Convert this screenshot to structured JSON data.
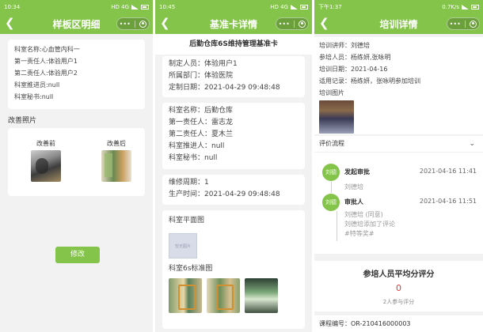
{
  "panel1": {
    "status": {
      "time": "10:34",
      "net": "HD 4G"
    },
    "title": "样板区明细",
    "info": [
      "科室名称:心血管内科一",
      "第一责任人:体验用户1",
      "第二责任人:体验用户2",
      "科室推进员:null",
      "科室秘书:null"
    ],
    "section_title": "改善照片",
    "before_label": "改善前",
    "after_label": "改善后",
    "edit_button": "修改"
  },
  "panel2": {
    "status": {
      "time": "10:45",
      "net": "HD 4G"
    },
    "title": "基准卡详情",
    "header": "后勤仓库6S维持管理基准卡",
    "card1": [
      "制定人员：体验用户1",
      "所属部门：体验医院",
      "定制日期：2021-04-29 09:48:48"
    ],
    "card2": [
      "科室名称：后勤仓库",
      "第一责任人：雷志龙",
      "第二责任人：夏木兰",
      "科室推进人：null",
      "科室秘书：null"
    ],
    "card3": [
      "维修周期：1",
      "生产时间：2021-04-29 09:48:48"
    ],
    "plan_label": "科室平面图",
    "plan_img_text": "暂无图片",
    "std_label": "科室6s标准图"
  },
  "panel3": {
    "status": {
      "time": "下午1:37",
      "net": "0.7K/s"
    },
    "title": "培训详情",
    "info": [
      "培训讲师：刘德培",
      "参培人员：杨练妍,张咏明",
      "培训日期：2021-04-16",
      "适用记录：杨练妍，张咏明参加培训",
      "培训图片"
    ],
    "flow_label": "评价流程",
    "flow": [
      {
        "avatar": "刘德",
        "title": "发起审批",
        "time": "2021-04-16 11:41",
        "sub": [
          "刘德培"
        ]
      },
      {
        "avatar": "刘德",
        "title": "审批人",
        "time": "2021-04-16 11:51",
        "sub": [
          "刘德培 (同意)",
          "刘德培添加了评论",
          "#特等奖#"
        ]
      }
    ],
    "score_title": "参培人员平均分评分",
    "score_value": "0",
    "score_people": "2人参与评分",
    "course": "课程编号：OR-210416000003"
  }
}
